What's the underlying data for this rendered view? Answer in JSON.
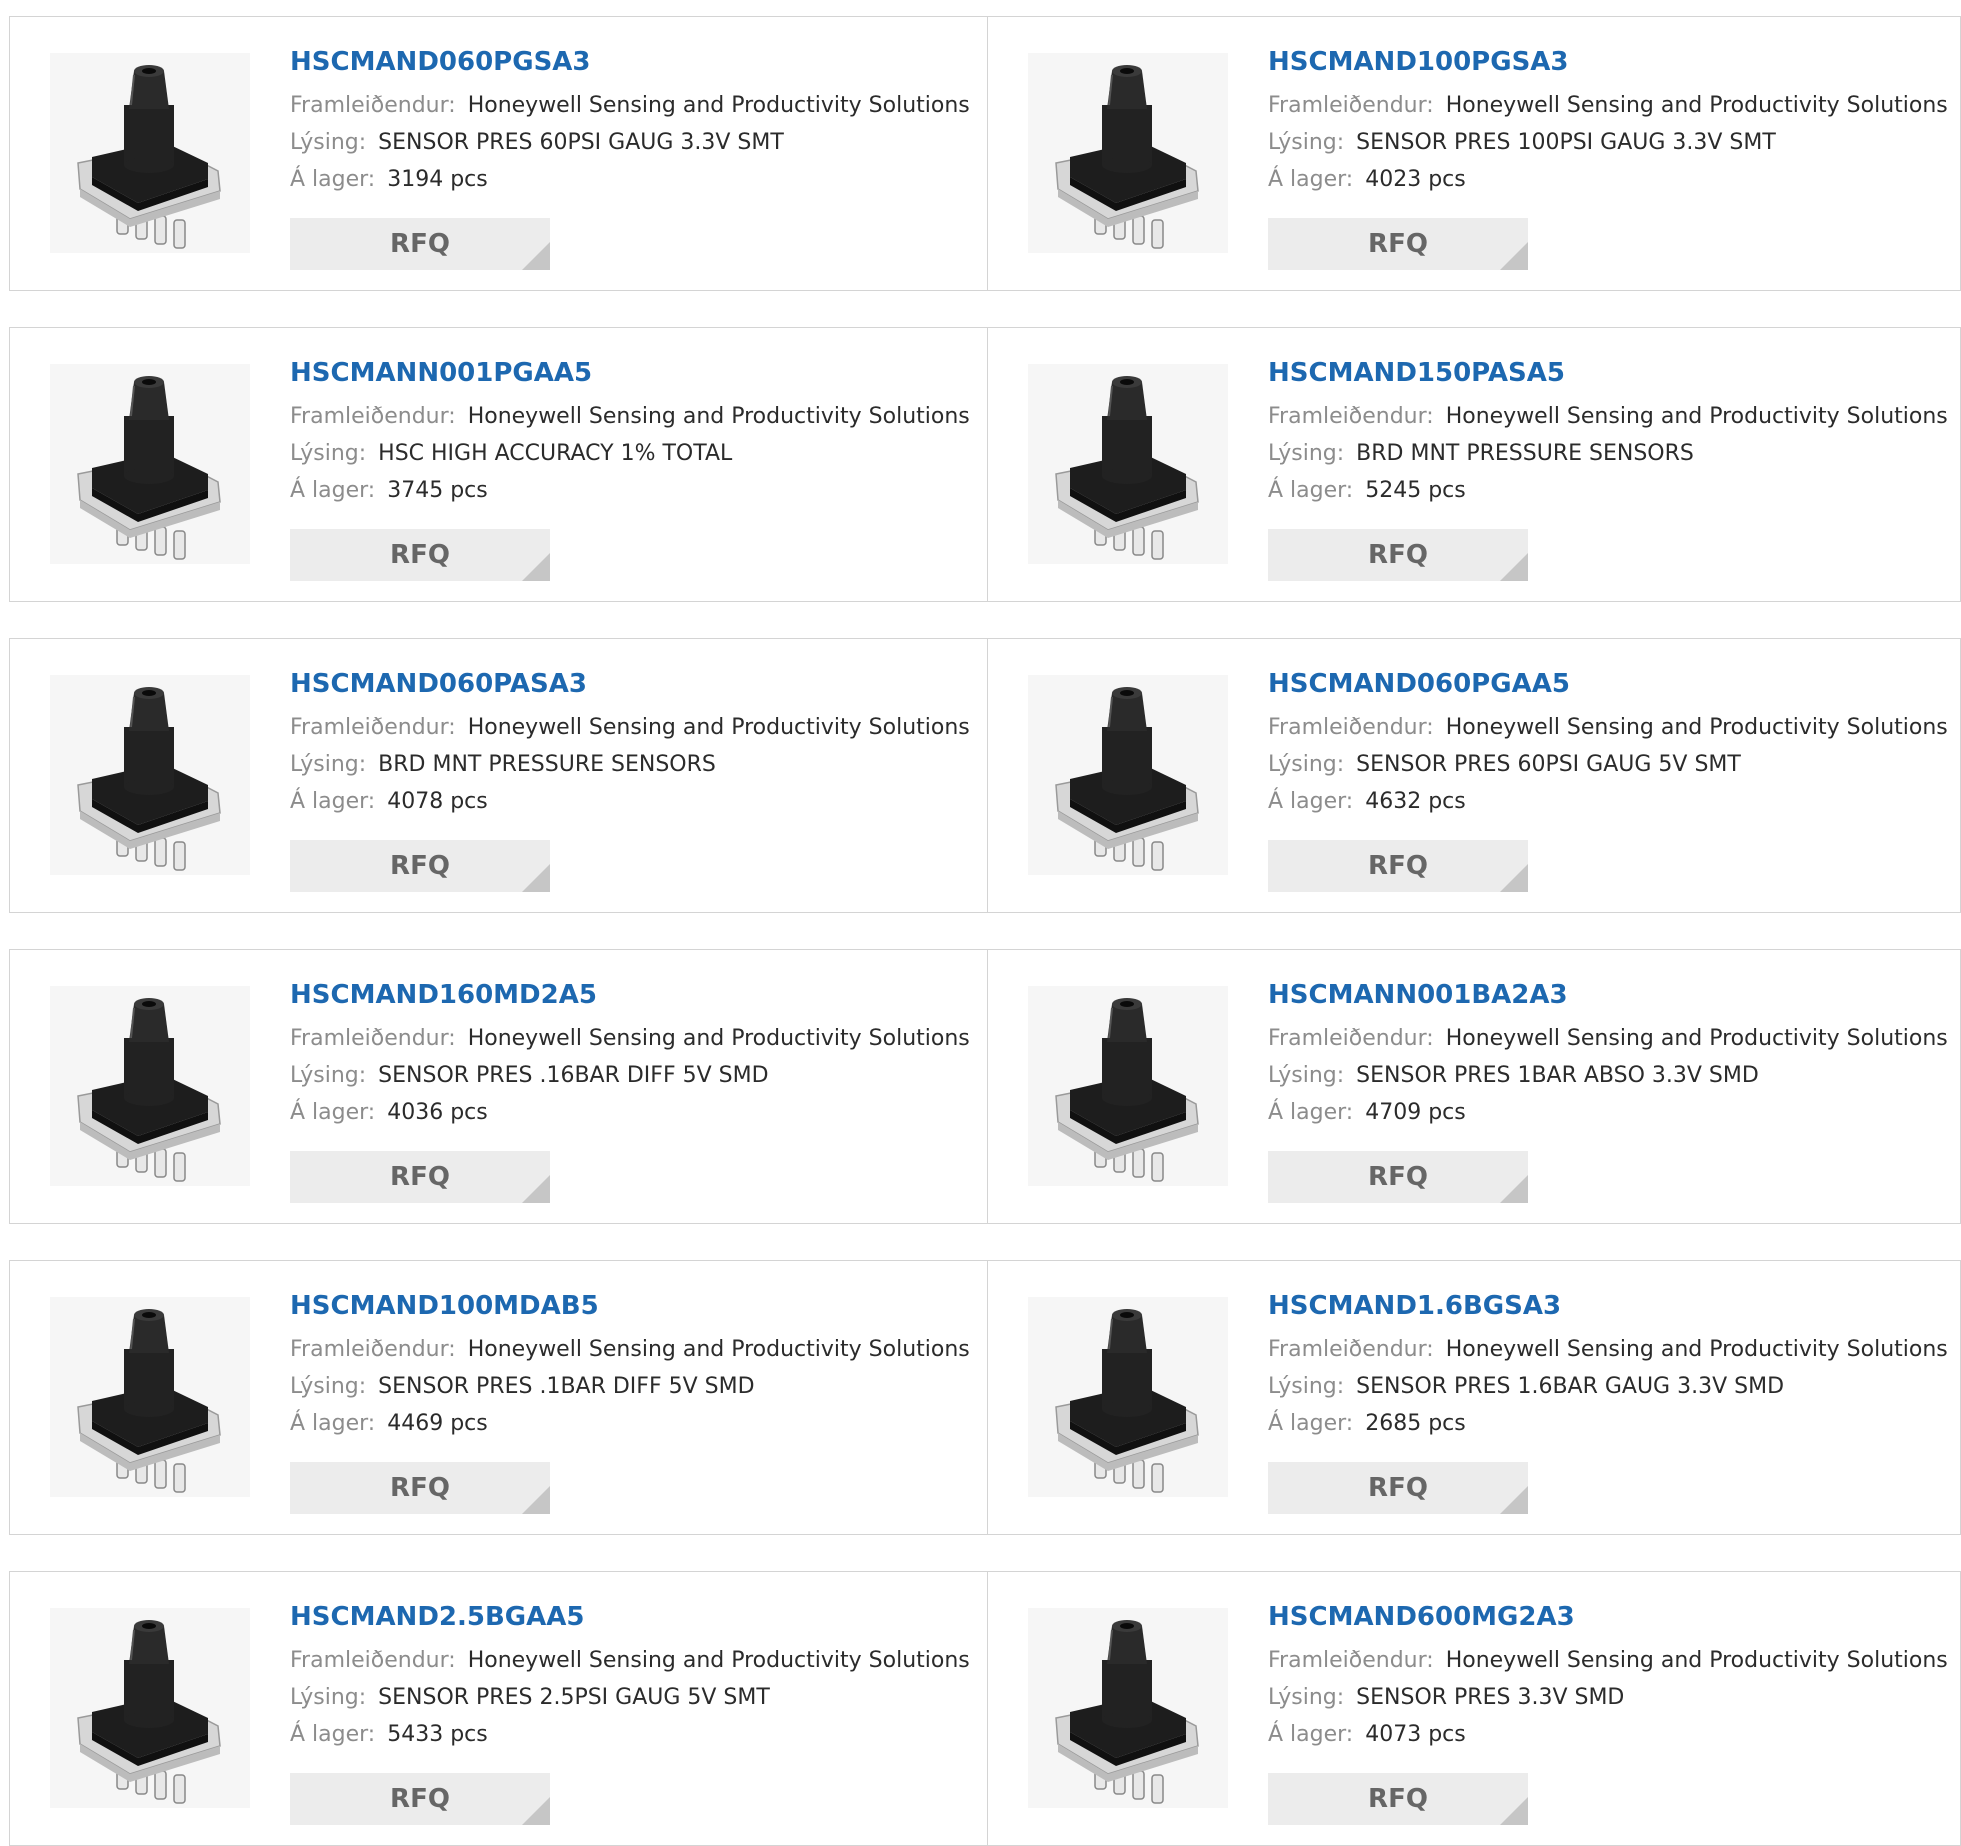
{
  "labels": {
    "manufacturer": "Framleiðendur:",
    "description": "Lýsing:",
    "stock": "Á lager:",
    "rfq": "RFQ"
  },
  "icons": {
    "product_image": "pressure-sensor-photo",
    "rfq_corner": "corner-triangle-icon"
  },
  "colors": {
    "part_link": "#1d68b0",
    "label": "#8c8c8c",
    "button_bg": "#ececec"
  },
  "products": [
    {
      "part": "HSCMAND060PGSA3",
      "manufacturer": "Honeywell Sensing and Productivity Solutions",
      "description": "SENSOR PRES 60PSI GAUG 3.3V SMT",
      "stock": "3194 pcs"
    },
    {
      "part": "HSCMAND100PGSA3",
      "manufacturer": "Honeywell Sensing and Productivity Solutions",
      "description": "SENSOR PRES 100PSI GAUG 3.3V SMT",
      "stock": "4023 pcs"
    },
    {
      "part": "HSCMANN001PGAA5",
      "manufacturer": "Honeywell Sensing and Productivity Solutions",
      "description": "HSC HIGH ACCURACY 1% TOTAL",
      "stock": "3745 pcs"
    },
    {
      "part": "HSCMAND150PASA5",
      "manufacturer": "Honeywell Sensing and Productivity Solutions",
      "description": "BRD MNT PRESSURE SENSORS",
      "stock": "5245 pcs"
    },
    {
      "part": "HSCMAND060PASA3",
      "manufacturer": "Honeywell Sensing and Productivity Solutions",
      "description": "BRD MNT PRESSURE SENSORS",
      "stock": "4078 pcs"
    },
    {
      "part": "HSCMAND060PGAA5",
      "manufacturer": "Honeywell Sensing and Productivity Solutions",
      "description": "SENSOR PRES 60PSI GAUG 5V SMT",
      "stock": "4632 pcs"
    },
    {
      "part": "HSCMAND160MD2A5",
      "manufacturer": "Honeywell Sensing and Productivity Solutions",
      "description": "SENSOR PRES .16BAR DIFF 5V SMD",
      "stock": "4036 pcs"
    },
    {
      "part": "HSCMANN001BA2A3",
      "manufacturer": "Honeywell Sensing and Productivity Solutions",
      "description": "SENSOR PRES 1BAR ABSO 3.3V SMD",
      "stock": "4709 pcs"
    },
    {
      "part": "HSCMAND100MDAB5",
      "manufacturer": "Honeywell Sensing and Productivity Solutions",
      "description": "SENSOR PRES .1BAR DIFF 5V SMD",
      "stock": "4469 pcs"
    },
    {
      "part": "HSCMAND1.6BGSA3",
      "manufacturer": "Honeywell Sensing and Productivity Solutions",
      "description": "SENSOR PRES 1.6BAR GAUG 3.3V SMD",
      "stock": "2685 pcs"
    },
    {
      "part": "HSCMAND2.5BGAA5",
      "manufacturer": "Honeywell Sensing and Productivity Solutions",
      "description": "SENSOR PRES 2.5PSI GAUG 5V SMT",
      "stock": "5433 pcs"
    },
    {
      "part": "HSCMAND600MG2A3",
      "manufacturer": "Honeywell Sensing and Productivity Solutions",
      "description": "SENSOR PRES 3.3V SMD",
      "stock": "4073 pcs"
    }
  ]
}
